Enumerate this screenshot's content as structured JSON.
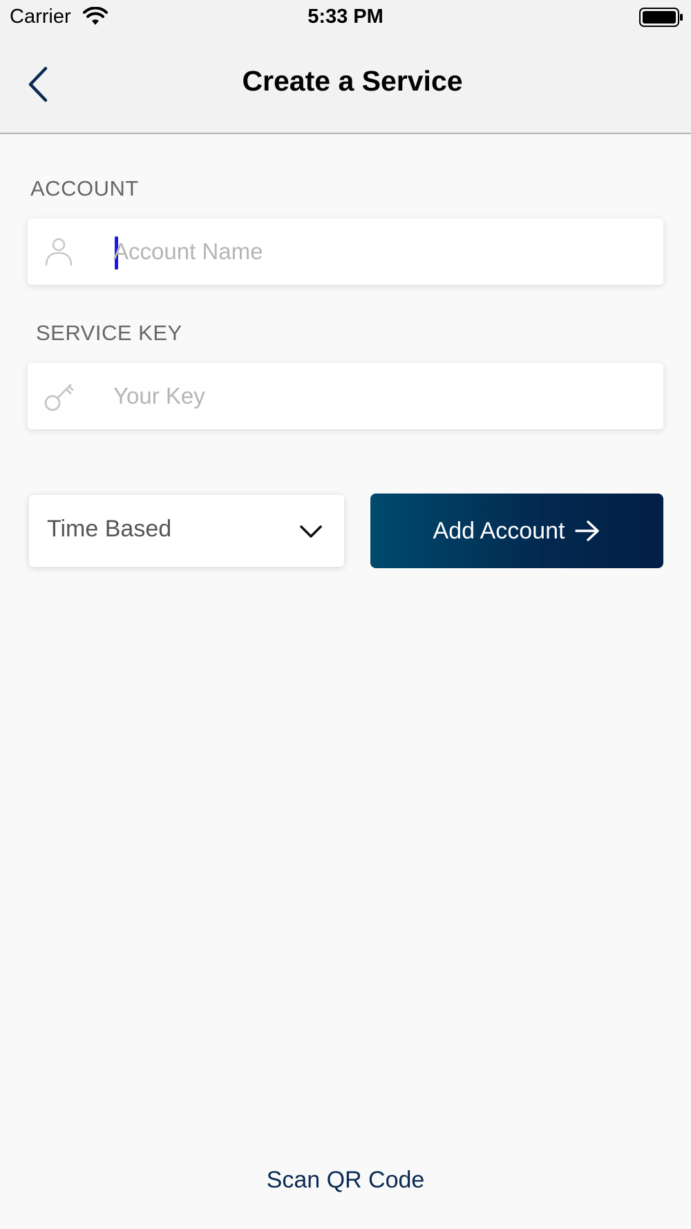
{
  "status_bar": {
    "carrier": "Carrier",
    "time": "5:33 PM"
  },
  "nav": {
    "title": "Create a Service",
    "back_icon": "chevron-left-icon"
  },
  "account": {
    "label": "ACCOUNT",
    "placeholder": "Account Name",
    "value": "",
    "icon": "user-icon"
  },
  "service_key": {
    "label": "SERVICE KEY",
    "placeholder": "Your Key",
    "value": "",
    "icon": "key-icon"
  },
  "type_select": {
    "selected": "Time Based",
    "icon": "chevron-down-icon"
  },
  "add_button": {
    "label": "Add Account",
    "icon": "arrow-right-icon"
  },
  "scan_link": {
    "label": "Scan QR Code"
  },
  "colors": {
    "accent_start": "#004a6d",
    "accent_end": "#021f45",
    "caret": "#1a19e6"
  }
}
